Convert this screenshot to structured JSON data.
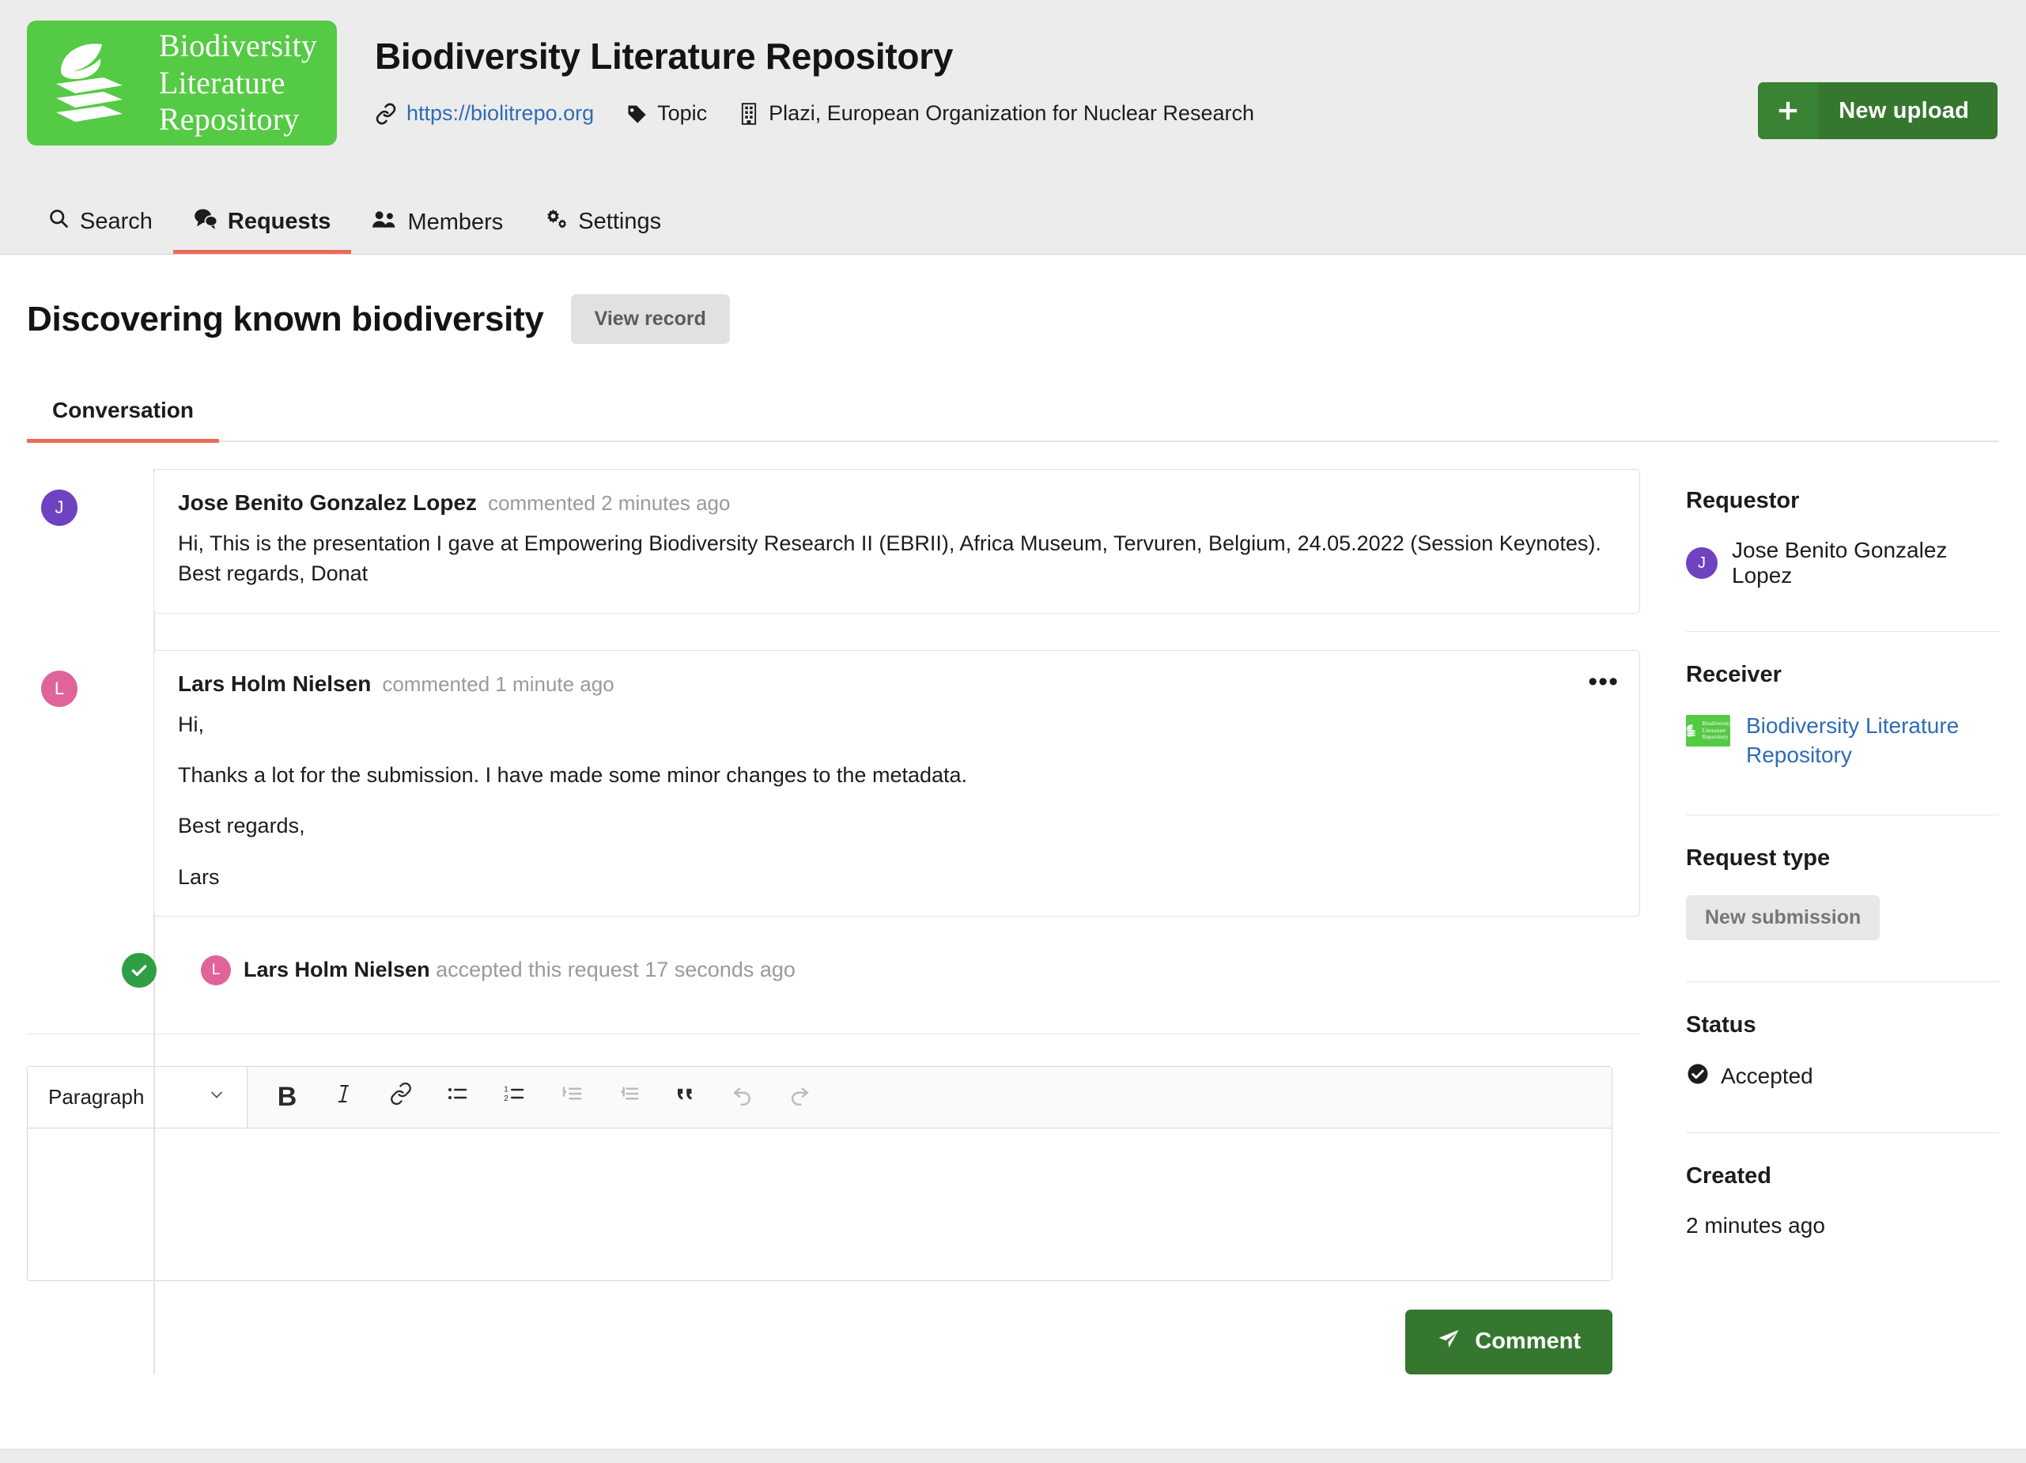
{
  "header": {
    "logo_alt": "Biodiversity Literature Repository",
    "logo_line1": "Biodiversity",
    "logo_line2": "Literature",
    "logo_line3": "Repository",
    "title": "Biodiversity Literature Repository",
    "url": "https://biolitrepo.org",
    "topic": "Topic",
    "organization": "Plazi, European Organization for Nuclear Research",
    "new_upload_label": "New upload",
    "brand_green": "#55ca44",
    "button_green": "#35772f",
    "link_blue": "#2e6cb5"
  },
  "nav": {
    "items": [
      {
        "label": "Search",
        "icon": "search-icon",
        "active": false
      },
      {
        "label": "Requests",
        "icon": "comments-icon",
        "active": true
      },
      {
        "label": "Members",
        "icon": "users-icon",
        "active": false
      },
      {
        "label": "Settings",
        "icon": "cogs-icon",
        "active": false
      }
    ],
    "active_underline": "#ed6a5a"
  },
  "page": {
    "request_title": "Discovering known biodiversity",
    "view_record_label": "View record",
    "tab_conversation": "Conversation"
  },
  "timeline": {
    "comments": [
      {
        "avatar_initial": "J",
        "avatar_color": "#6f42c1",
        "author": "Jose Benito Gonzalez Lopez",
        "when": "commented 2 minutes ago",
        "paragraphs": [
          "Hi, This is the presentation I gave at Empowering Biodiversity Research II (EBRII), Africa Museum, Tervuren, Belgium, 24.05.2022 (Session Keynotes).",
          "Best regards, Donat"
        ],
        "has_menu": false
      },
      {
        "avatar_initial": "L",
        "avatar_color": "#e0649a",
        "author": "Lars Holm Nielsen",
        "when": "commented 1 minute ago",
        "paragraphs": [
          "Hi,",
          "Thanks a lot for the submission. I have made some minor changes to the metadata.",
          "Best regards,",
          "Lars"
        ],
        "has_menu": true,
        "menu_label": "•••"
      }
    ],
    "event": {
      "avatar_initial": "L",
      "avatar_color": "#e0649a",
      "who": "Lars Holm Nielsen",
      "what": "accepted this request 17 seconds ago",
      "badge_color": "#2f9e44"
    }
  },
  "editor": {
    "format_value": "Paragraph",
    "tools": [
      {
        "name": "bold-icon",
        "label": "B",
        "disabled": false
      },
      {
        "name": "italic-icon",
        "label": "I",
        "disabled": false
      },
      {
        "name": "link-icon",
        "label": "",
        "disabled": false
      },
      {
        "name": "bullet-list-icon",
        "label": "",
        "disabled": false
      },
      {
        "name": "numbered-list-icon",
        "label": "",
        "disabled": false
      },
      {
        "name": "indent-icon",
        "label": "",
        "disabled": true
      },
      {
        "name": "outdent-icon",
        "label": "",
        "disabled": true
      },
      {
        "name": "blockquote-icon",
        "label": "",
        "disabled": false
      },
      {
        "name": "undo-icon",
        "label": "",
        "disabled": true
      },
      {
        "name": "redo-icon",
        "label": "",
        "disabled": true
      }
    ],
    "body_value": "",
    "submit_label": "Comment"
  },
  "sidebar": {
    "requestor_title": "Requestor",
    "requestor_name": "Jose Benito Gonzalez Lopez",
    "requestor_initial": "J",
    "requestor_color": "#6f42c1",
    "receiver_title": "Receiver",
    "receiver_name": "Biodiversity Literature Repository",
    "receiver_logo_line1": "Biodiversity",
    "receiver_logo_line2": "Literature",
    "receiver_logo_line3": "Repository",
    "request_type_title": "Request type",
    "request_type_value": "New submission",
    "status_title": "Status",
    "status_value": "Accepted",
    "created_title": "Created",
    "created_value": "2 minutes ago"
  }
}
